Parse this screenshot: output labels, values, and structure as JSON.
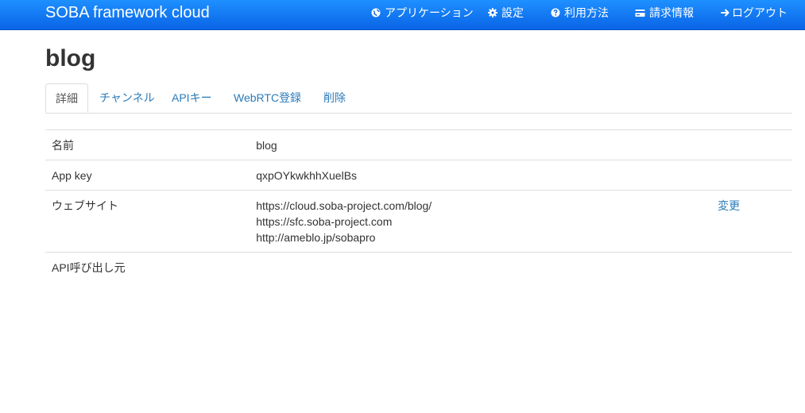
{
  "navbar": {
    "brand": "SOBA framework cloud",
    "items": [
      {
        "label": "アプリケーション",
        "icon": "globe-icon"
      },
      {
        "label": "設定",
        "icon": "gear-icon"
      },
      {
        "label": "利用方法",
        "icon": "question-icon"
      },
      {
        "label": "請求情報",
        "icon": "credit-card-icon"
      },
      {
        "label": "ログアウト",
        "icon": "arrow-right-icon"
      }
    ]
  },
  "page": {
    "title": "blog"
  },
  "tabs": [
    {
      "label": "詳細",
      "active": true
    },
    {
      "label": "チャンネル",
      "active": false
    },
    {
      "label": "APIキー",
      "active": false
    },
    {
      "label": "WebRTC登録",
      "active": false
    },
    {
      "label": "削除",
      "active": false
    }
  ],
  "details": {
    "name": {
      "label": "名前",
      "value": "blog"
    },
    "app_key": {
      "label": "App key",
      "value": "qxpOYkwkhhXuelBs"
    },
    "websites": {
      "label": "ウェブサイト",
      "values": [
        "https://cloud.soba-project.com/blog/",
        "https://sfc.soba-project.com",
        "http://ameblo.jp/sobapro"
      ],
      "action": "変更"
    },
    "api_caller": {
      "label": "API呼び出し元"
    }
  },
  "colors": {
    "navbar": "#0a64e6",
    "link": "#2a7ab8",
    "border": "#dddddd"
  }
}
